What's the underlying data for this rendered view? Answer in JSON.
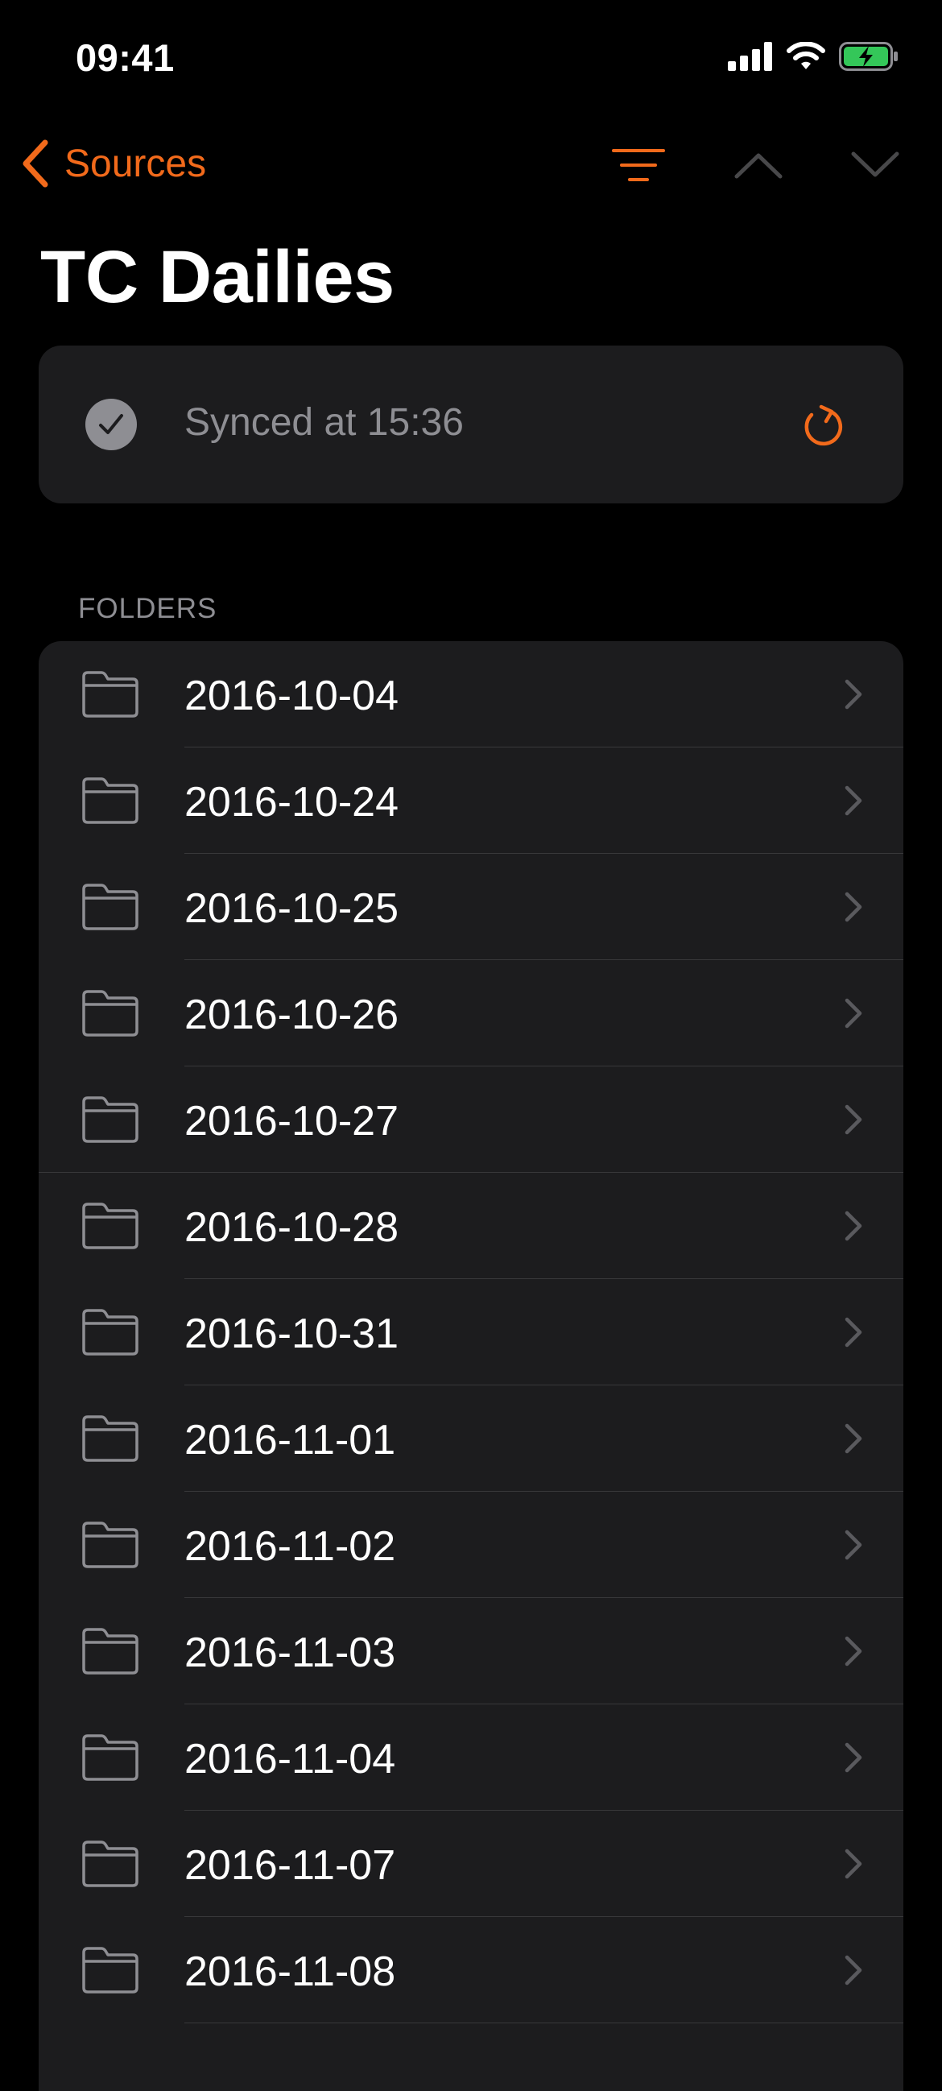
{
  "status_bar": {
    "time": "09:41"
  },
  "nav": {
    "back_label": "Sources",
    "accent_color": "#f26a1b"
  },
  "page": {
    "title": "TC Dailies"
  },
  "sync": {
    "status_text": "Synced at 15:36",
    "status_icon": "checkmark-circle-icon",
    "refresh_icon": "refresh-icon"
  },
  "folders": {
    "header": "FOLDERS",
    "items": [
      {
        "label": "2016-10-04"
      },
      {
        "label": "2016-10-24"
      },
      {
        "label": "2016-10-25"
      },
      {
        "label": "2016-10-26"
      },
      {
        "label": "2016-10-27"
      },
      {
        "label": "2016-10-28"
      },
      {
        "label": "2016-10-31"
      },
      {
        "label": "2016-11-01"
      },
      {
        "label": "2016-11-02"
      },
      {
        "label": "2016-11-03"
      },
      {
        "label": "2016-11-04"
      },
      {
        "label": "2016-11-07"
      },
      {
        "label": "2016-11-08"
      }
    ]
  },
  "colors": {
    "background": "#000000",
    "card": "#1c1c1e",
    "accent": "#f26a1b",
    "secondary_text": "#8e8e93",
    "battery_fill": "#34c759"
  }
}
